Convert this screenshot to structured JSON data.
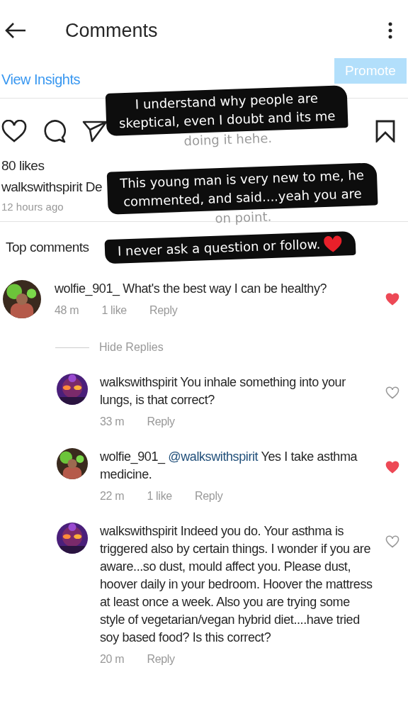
{
  "header": {
    "title": "Comments"
  },
  "insights": {
    "link": "View Insights",
    "button": "Promote"
  },
  "post": {
    "likes": "80 likes",
    "caption_user": "walkswithspirit",
    "caption_text": "De",
    "time": "12 hours ago"
  },
  "top_comments_label": "Top comments",
  "comments": [
    {
      "user": "wolfie_901_",
      "text": "What's the best way I can be healthy?",
      "time": "48 m",
      "likes": "1 like",
      "reply": "Reply",
      "liked": true,
      "hide_replies": "Hide Replies",
      "children": [
        {
          "user": "walkswithspirit",
          "text": "You inhale something into your lungs, is that correct?",
          "time": "33 m",
          "reply": "Reply",
          "liked": false
        },
        {
          "user": "wolfie_901_",
          "mention": "@walkswithspirit",
          "text": "Yes I take asthma medicine.",
          "time": "22 m",
          "likes": "1 like",
          "reply": "Reply",
          "liked": true
        },
        {
          "user": "walkswithspirit",
          "text": "Indeed you do.  Your asthma is triggered also by certain things. I wonder if you are aware...so dust, mould affect you. Please dust, hoover daily in your bedroom. Hoover the mattress at least once a week.  Also you are trying some style of vegetarian/vegan hybrid diet....have tried soy based food? Is this correct?",
          "time": "20 m",
          "reply": "Reply",
          "liked": false
        }
      ]
    }
  ],
  "notes": [
    {
      "lines": [
        "I understand why people are",
        "skeptical, even I doubt and its me"
      ],
      "tail": "doing it hehe."
    },
    {
      "lines": [
        "This young man is very new to me, he",
        "commented, and said....yeah you are"
      ],
      "tail": "on point."
    },
    {
      "lines": [
        "I never ask a question or follow."
      ],
      "heart": true
    }
  ]
}
